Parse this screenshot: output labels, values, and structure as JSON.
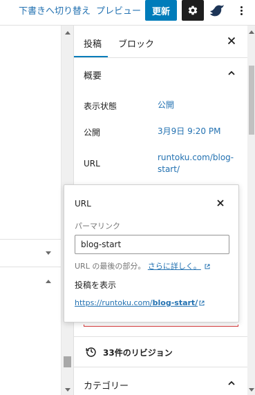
{
  "toolbar": {
    "switch_to_draft": "下書きへ切り替え",
    "preview": "プレビュー",
    "update": "更新",
    "settings_icon": "gear-icon",
    "plugin_icon": "bird-icon",
    "more_icon": "vertical-ellipsis-icon"
  },
  "sidebar": {
    "tabs": [
      {
        "label": "投稿",
        "active": true
      },
      {
        "label": "ブロック",
        "active": false
      }
    ],
    "summary": {
      "title": "概要",
      "rows": [
        {
          "label": "表示状態",
          "value": "公開"
        },
        {
          "label": "公開",
          "value": "3月9日 9:20 PM"
        },
        {
          "label": "URL",
          "value_line1": "runtoku.com/blog-",
          "value_line2": "start/"
        }
      ]
    },
    "revisions": {
      "label": "33件のリビジョン"
    },
    "categories": {
      "title": "カテゴリー"
    }
  },
  "url_popover": {
    "title": "URL",
    "permalink_label": "パーマリンク",
    "slug_value": "blog-start",
    "help_text": "URL の最後の部分。",
    "help_link": "さらに詳しく。",
    "view_post_label": "投稿を表示",
    "post_link_prefix": "https://runtoku.com/",
    "post_link_slug": "blog-start/"
  },
  "colors": {
    "accent": "#007cba",
    "link": "#2271b1",
    "dark": "#1e1e1e",
    "error_border": "#d63638"
  }
}
